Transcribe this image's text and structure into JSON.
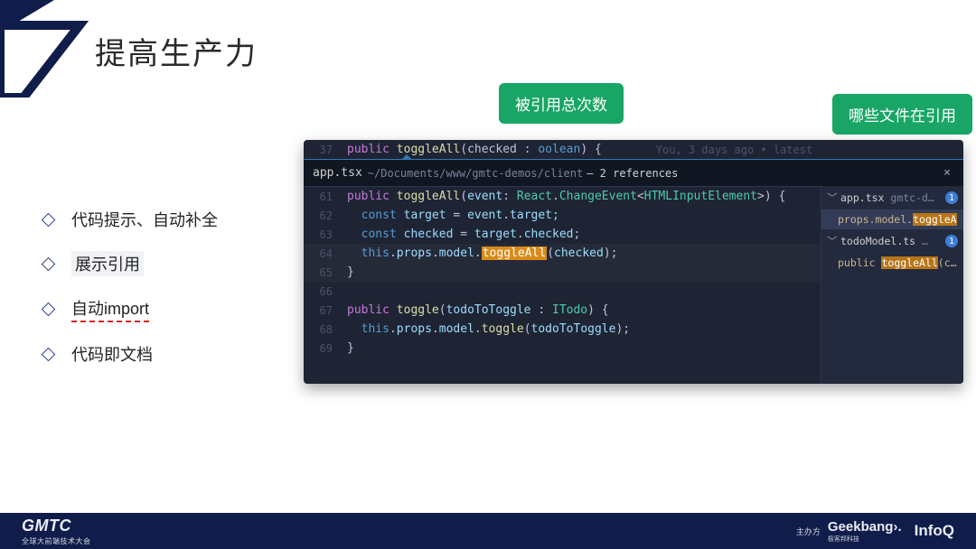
{
  "title": "提高生产力",
  "bullets": [
    {
      "plain": "代码提示、自动补全",
      "dashed": false,
      "highlight": false
    },
    {
      "plain": "展示引用",
      "dashed": false,
      "highlight": true
    },
    {
      "plain": "自动import",
      "dashed": true,
      "highlight": false
    },
    {
      "plain": "代码即文档",
      "dashed": false,
      "highlight": false
    }
  ],
  "callout1": "被引用总次数",
  "callout2": "哪些文件在引用",
  "top_line": {
    "num": "37",
    "public": "public ",
    "fn": "toggleAll",
    "after_fn": "(checked : ",
    "ty": "oolean",
    "tail": ") {",
    "blame": "You, 3 days ago • latest"
  },
  "peek": {
    "file": "app.tsx",
    "path": "~/Documents/www/gmtc-demos/client",
    "refs": " – 2 references",
    "close": "×"
  },
  "body": [
    {
      "n": "61",
      "html": "<span class='kw'>public</span> <span class='fn'>toggleAll</span>(<span class='pr'>event</span>: <span class='ty'>React</span>.<span class='ty'>ChangeEvent</span>&lt;<span class='ty'>HTMLInputElement</span>&gt;) {"
    },
    {
      "n": "62",
      "html": "  <span class='kw2'>const</span> <span class='pr'>target</span> = <span class='pr'>event</span>.<span class='pr'>target</span>;"
    },
    {
      "n": "63",
      "html": "  <span class='kw2'>const</span> <span class='pr'>checked</span> = <span class='pr'>target</span>.<span class='pr'>checked</span>;"
    },
    {
      "n": "64",
      "html": "  <span class='kw2'>this</span>.<span class='pr'>props</span>.<span class='pr'>model</span>.<span class='highlight-tok'>toggleAll</span>(<span class='pr'>checked</span>);",
      "dim": true
    },
    {
      "n": "65",
      "html": "}",
      "dim": true
    },
    {
      "n": "66",
      "html": ""
    },
    {
      "n": "67",
      "html": "<span class='kw'>public</span> <span class='fn'>toggle</span>(<span class='pr'>todoToToggle</span> : <span class='ty'>ITodo</span>) {"
    },
    {
      "n": "68",
      "html": "  <span class='kw2'>this</span>.<span class='pr'>props</span>.<span class='pr'>model</span>.<span class='fn'>toggle</span>(<span class='pr'>todoToToggle</span>);"
    },
    {
      "n": "69",
      "html": "}"
    }
  ],
  "refs": {
    "files": [
      {
        "name": "app.tsx",
        "detail": "gmtc-d…",
        "count": "1",
        "line_pre": "props.model.",
        "line_hl": "toggleA",
        "selected": true
      },
      {
        "name": "todoModel.ts",
        "detail": "…",
        "count": "1",
        "line_pre": "public ",
        "line_hl": "toggleAll",
        "line_post": "(chec",
        "selected": false
      }
    ]
  },
  "footer": {
    "brand": "GMTC",
    "sub": "全球大前端技术大会",
    "host": "主办方",
    "gb": "Geekbang›.",
    "gbsub": "极客邦科技",
    "iq": "InfoQ"
  }
}
